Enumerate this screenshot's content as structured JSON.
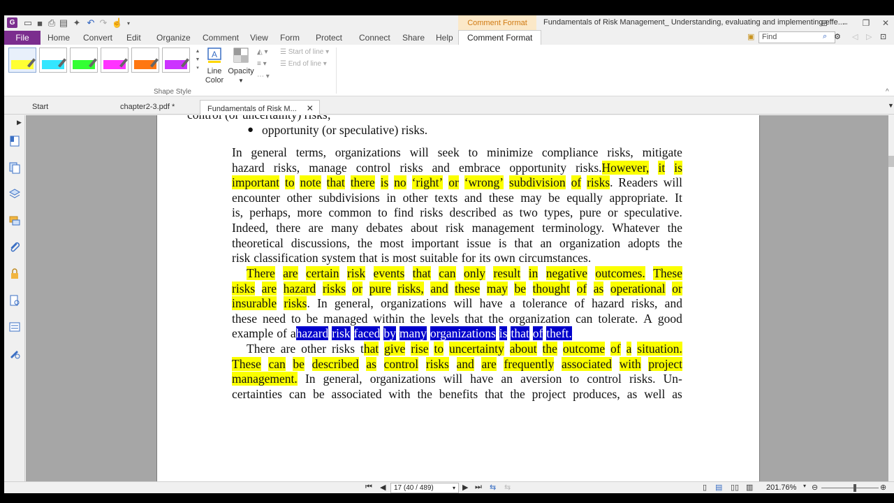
{
  "app": {
    "context_tab_top": "Comment Format",
    "document_title": "Fundamentals of Risk Management_ Understanding, evaluating and implementing effe...",
    "accent": "#7b2d8e"
  },
  "menu": {
    "file": "File",
    "tabs": [
      "Home",
      "Convert",
      "Edit",
      "Organize",
      "Comment",
      "View",
      "Form",
      "Protect",
      "Connect",
      "Share",
      "Help"
    ],
    "active_tab": "Comment Format",
    "find_placeholder": "Find"
  },
  "ribbon": {
    "swatch_colors": [
      "#ffff33",
      "#33e6ff",
      "#33ff33",
      "#ff33ff",
      "#ff7711",
      "#cc33ff"
    ],
    "line_color_label_1": "Line",
    "line_color_label_2": "Color",
    "opacity_label": "Opacity",
    "start_of_line": "Start of line",
    "end_of_line": "End of line",
    "group_label": "Shape Style"
  },
  "tabs": {
    "start": "Start",
    "chapter": "chapter2-3.pdf *",
    "current": "Fundamentals of Risk M..."
  },
  "document": {
    "cut_line": "control (or uncertainty) risks;",
    "bullet_text": "opportunity (or speculative) risks.",
    "p1": [
      [
        {
          "t": "In general terms, organizations will seek to minimize compliance risks, mitigate",
          "s": ""
        }
      ],
      [
        {
          "t": "hazard risks, manage control risks and embrace opportunity risks. ",
          "s": ""
        },
        {
          "t": "However, it is",
          "s": "hl"
        }
      ],
      [
        {
          "t": "important to note that there is no ‘right’ or ‘wrong’ subdivision of risks",
          "s": "hl"
        },
        {
          "t": ". Readers will",
          "s": ""
        }
      ],
      [
        {
          "t": "encounter other subdivisions in other texts and these may be equally appropriate. It",
          "s": ""
        }
      ],
      [
        {
          "t": "is, perhaps, more common to find risks described as two types, pure or speculative.",
          "s": ""
        }
      ],
      [
        {
          "t": "Indeed, there are many debates about risk management terminology. Whatever the",
          "s": ""
        }
      ],
      [
        {
          "t": "theoretical discussions, the most important issue is that an organization adopts the",
          "s": ""
        }
      ],
      [
        {
          "t": "risk classification system that is most suitable for its own circumstances.",
          "s": "",
          "last": true
        }
      ]
    ],
    "p2": [
      [
        {
          "t": "There are certain risk events that can only result in negative outcomes. These",
          "s": "hl",
          "indent": true
        }
      ],
      [
        {
          "t": "risks are hazard risks or pure risks, and these may be thought of as operational or",
          "s": "hl"
        }
      ],
      [
        {
          "t": "insurable risks",
          "s": "hl"
        },
        {
          "t": ". In general, organizations will have a tolerance of hazard risks, and",
          "s": ""
        }
      ],
      [
        {
          "t": "these need to be managed within the levels that the organization can tolerate. A good",
          "s": ""
        }
      ],
      [
        {
          "t": "example of a ",
          "s": ""
        },
        {
          "t": "hazard risk faced by many organizations is that of theft.",
          "s": "sel",
          "last": true
        }
      ]
    ],
    "p3": [
      [
        {
          "t": "There are other risks t",
          "s": "",
          "indent": true
        },
        {
          "t": "hat give rise to uncertainty about the outcome of a situation.",
          "s": "hl"
        }
      ],
      [
        {
          "t": "These can be described as control risks and are frequently associated with project",
          "s": "hl"
        }
      ],
      [
        {
          "t": "management.",
          "s": "hl"
        },
        {
          "t": " In general, organizations will have an aversion to control risks. Un-",
          "s": ""
        }
      ],
      [
        {
          "t": "certainties can be associated with the benefits that the project produces, as well as",
          "s": ""
        }
      ]
    ]
  },
  "status": {
    "page_indicator": "17 (40 / 489)",
    "zoom": "201.76%"
  }
}
